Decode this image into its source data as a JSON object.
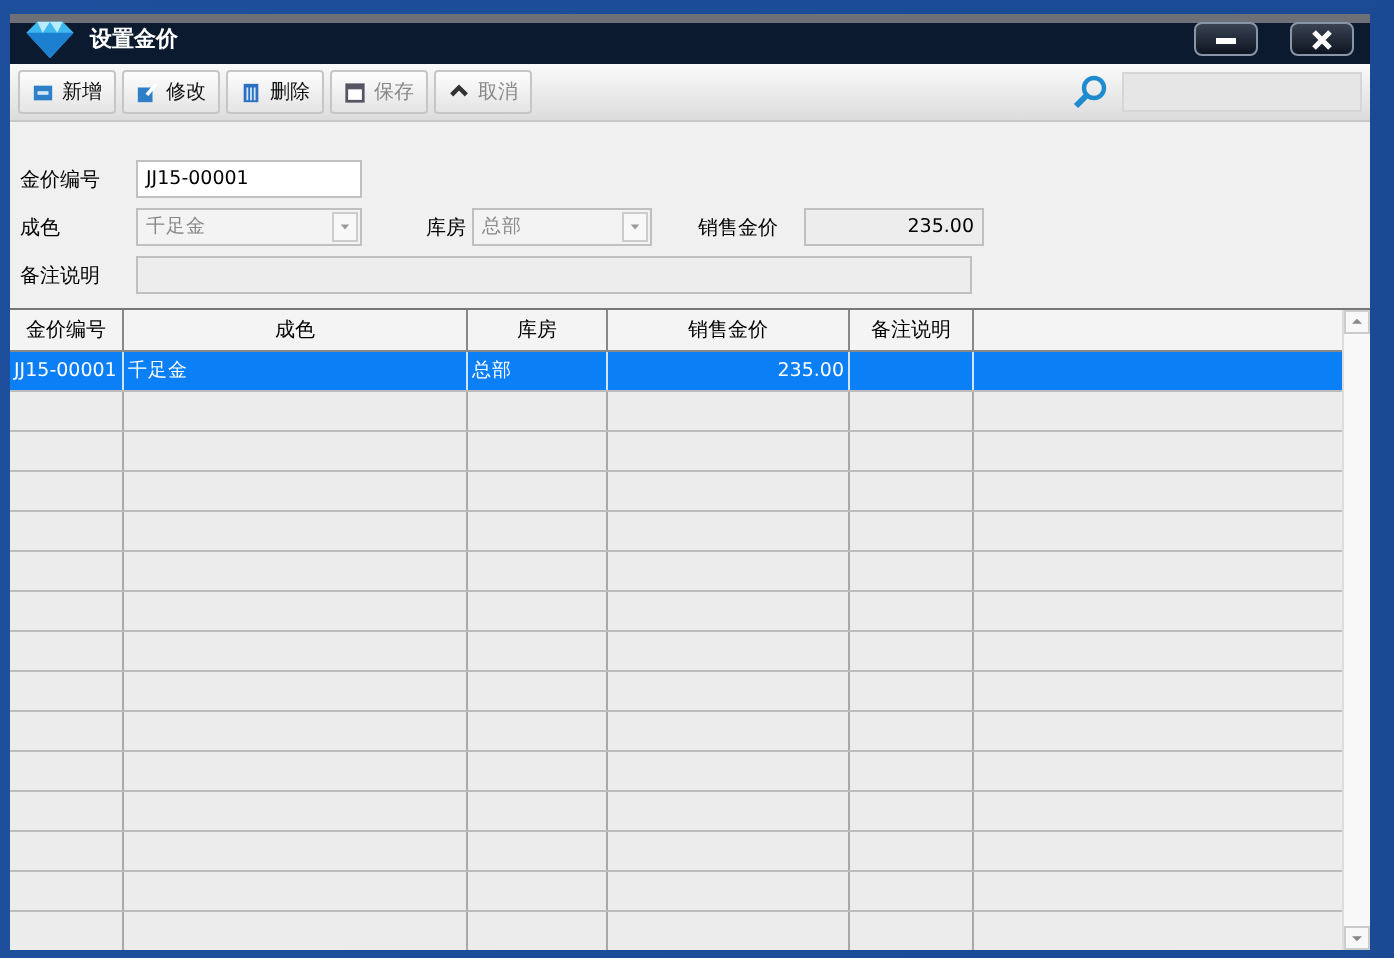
{
  "window": {
    "title": "设置金价"
  },
  "toolbar": [
    {
      "label": "新增",
      "disabled": false
    },
    {
      "label": "修改",
      "disabled": false
    },
    {
      "label": "删除",
      "disabled": false
    },
    {
      "label": "保存",
      "disabled": true
    },
    {
      "label": "取消",
      "disabled": true
    }
  ],
  "form": {
    "code": {
      "label": "金价编号",
      "value": "JJ15-00001"
    },
    "purity": {
      "label": "成色",
      "value": "千足金",
      "disabled": true
    },
    "store": {
      "label": "库房",
      "value": "总部",
      "disabled": true
    },
    "price": {
      "label": "销售金价",
      "value": "235.00"
    },
    "note": {
      "label": "备注说明"
    }
  },
  "table": {
    "columns": [
      "金价编号",
      "成色",
      "库房",
      "销售金价",
      "备注说明"
    ],
    "rows": [
      {
        "cells": [
          "JJ15-00001",
          "千足金",
          "总部",
          "235.00",
          ""
        ],
        "selected": true
      }
    ]
  }
}
